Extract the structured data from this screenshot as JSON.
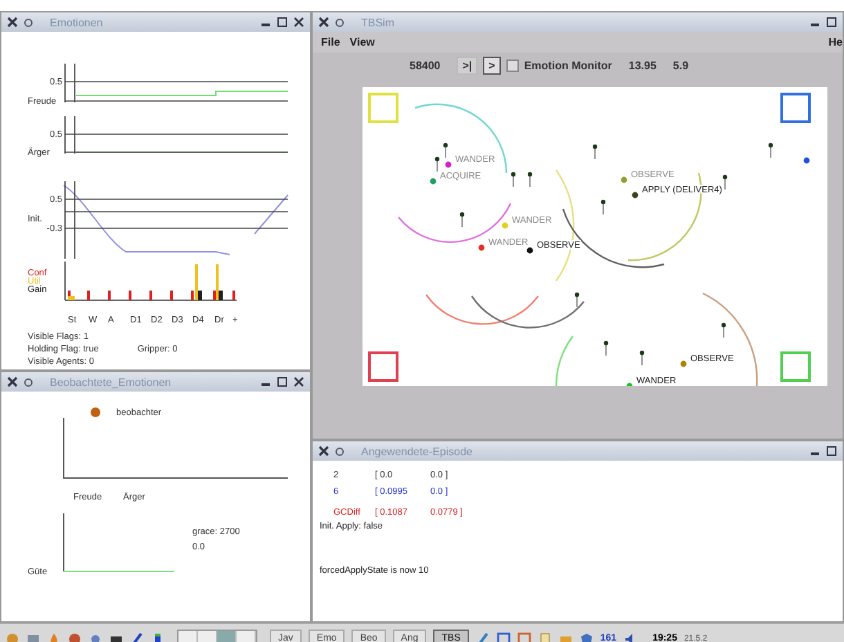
{
  "emotions": {
    "title": "Emotionen",
    "plots": [
      {
        "label": "Freude",
        "ticks": [
          "0.5"
        ]
      },
      {
        "label": "Ärger",
        "ticks": [
          "0.5"
        ]
      },
      {
        "label": "Init.",
        "ticks": [
          "0.5",
          "-0.3"
        ]
      }
    ],
    "legend": [
      {
        "label": "Conf",
        "color": "#e02020"
      },
      {
        "label": "Util",
        "color": "#f0c020"
      },
      {
        "label": "Gain",
        "color": "#202020"
      }
    ],
    "categories": [
      "St",
      "W",
      "A",
      "D1",
      "D2",
      "D3",
      "D4",
      "Dr",
      "+"
    ],
    "status": [
      "Visible Flags: 1",
      "Holding Flag: true",
      "Gripper: 0",
      "Visible Agents: 0"
    ]
  },
  "observed": {
    "title": "Beobachtete_Emotionen",
    "legend": {
      "label": "beobachter",
      "color": "#c06010"
    },
    "axis_labels": [
      "Freude",
      "Ärger"
    ],
    "lower_label": "Güte",
    "readings": [
      "grace: 2700",
      "0.0"
    ]
  },
  "sim": {
    "title": "TBSim",
    "menu": [
      "File",
      "View",
      "He"
    ],
    "counter": "58400",
    "buttons": [
      {
        "label": ">|",
        "selected": false
      },
      {
        "label": ">",
        "selected": true
      }
    ],
    "monitor": {
      "label": "Emotion Monitor",
      "checked": false
    },
    "values": [
      "13.95",
      "5.9"
    ],
    "bases": [
      {
        "color": "#e0e040"
      },
      {
        "color": "#3070e0"
      },
      {
        "color": "#e04050"
      },
      {
        "color": "#50d050"
      }
    ],
    "agents": [
      {
        "label": "WANDER",
        "color": "#d020d0"
      },
      {
        "label": "ACQUIRE",
        "color": "#20a060"
      },
      {
        "label": "WANDER",
        "color": "#e0d020"
      },
      {
        "label": "WANDER",
        "color": "#e03020"
      },
      {
        "label": "OBSERVE",
        "color": "#111111"
      },
      {
        "label": "OBSERVE",
        "color": "#90a030"
      },
      {
        "label": "APPLY (DELIVER4)",
        "color": "#404020"
      },
      {
        "label": "OBSERVE",
        "color": "#b08000"
      },
      {
        "label": "WANDER",
        "color": "#20c020"
      },
      {
        "color": "#2050e0"
      }
    ]
  },
  "episode": {
    "title": "Angewendete-Episode",
    "rows": [
      {
        "cells": [
          "2",
          "[ 0.0",
          "0.0 ]"
        ],
        "color": "#333333"
      },
      {
        "cells": [
          "6",
          "[ 0.0995",
          "0.0 ]"
        ],
        "color": "#2030d0"
      },
      {
        "cells": [
          "GCDiff",
          "[ 0.1087",
          "0.0779 ]"
        ],
        "color": "#e02020"
      }
    ],
    "lines": [
      "Init. Apply: false",
      "forcedApplyState is now 10"
    ]
  },
  "taskbar": {
    "tasks": [
      {
        "label": "Jav",
        "selected": false
      },
      {
        "label": "Emo",
        "selected": false
      },
      {
        "label": "Beo",
        "selected": false
      },
      {
        "label": "Ang",
        "selected": false
      },
      {
        "label": "TBS",
        "selected": true
      }
    ],
    "tray_count": "161",
    "clock": "19:25",
    "date": "21.5.2"
  }
}
